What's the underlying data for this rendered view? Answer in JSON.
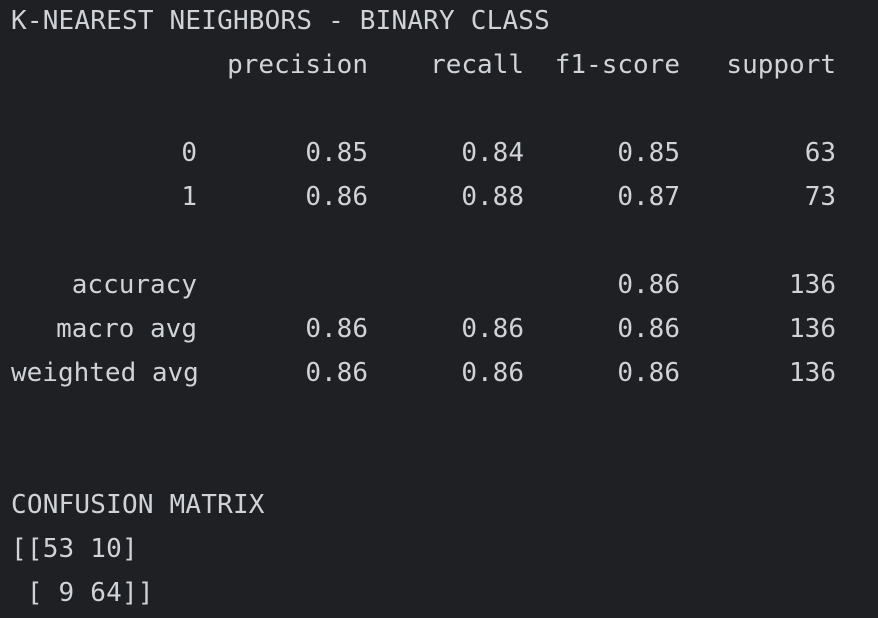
{
  "report": {
    "title": "K-NEAREST NEIGHBORS - BINARY CLASS",
    "headers": {
      "precision": "precision",
      "recall": "recall",
      "f1": "f1-score",
      "support": "support"
    },
    "rows": [
      {
        "label": "0",
        "precision": "0.85",
        "recall": "0.84",
        "f1": "0.85",
        "support": "63"
      },
      {
        "label": "1",
        "precision": "0.86",
        "recall": "0.88",
        "f1": "0.87",
        "support": "73"
      }
    ],
    "summary": [
      {
        "label": "accuracy",
        "precision": "",
        "recall": "",
        "f1": "0.86",
        "support": "136"
      },
      {
        "label": "macro avg",
        "precision": "0.86",
        "recall": "0.86",
        "f1": "0.86",
        "support": "136"
      },
      {
        "label": "weighted avg",
        "precision": "0.86",
        "recall": "0.86",
        "f1": "0.86",
        "support": "136"
      }
    ]
  },
  "confusion": {
    "title": "CONFUSION MATRIX",
    "line1": "[[53 10]",
    "line2": " [ 9 64]]"
  }
}
